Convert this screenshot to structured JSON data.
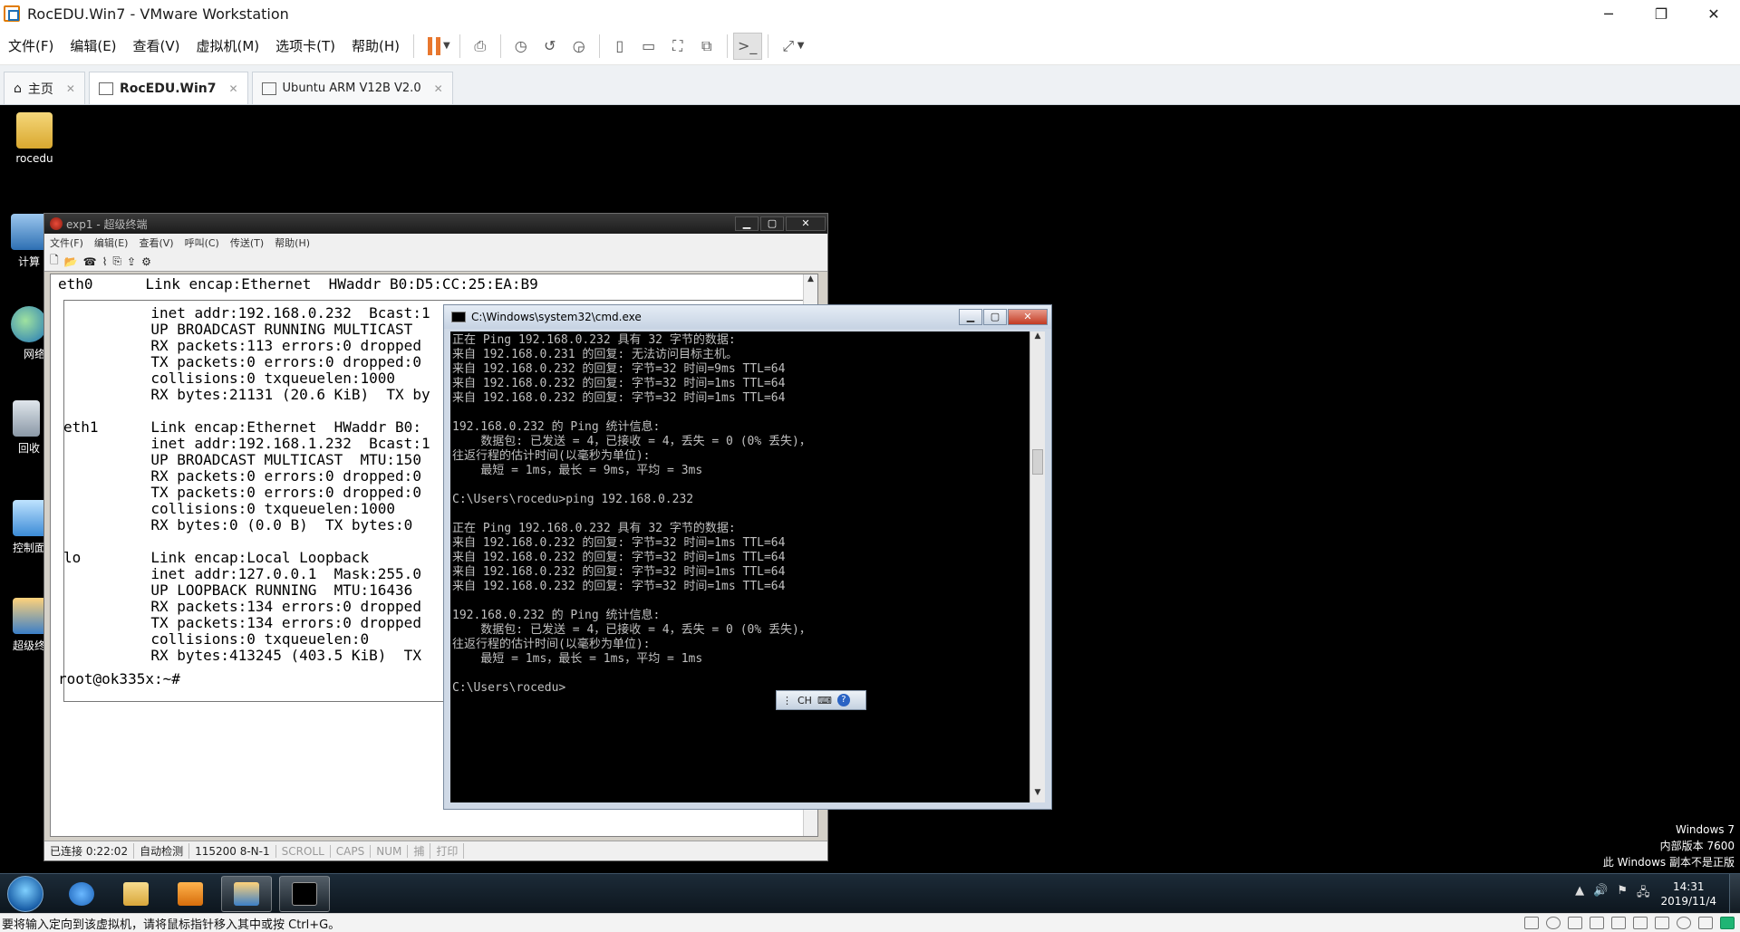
{
  "host": {
    "title": "RocEDU.Win7 - VMware Workstation",
    "window_controls": {
      "minimize": "─",
      "restore": "❐",
      "close": "✕"
    },
    "menu": [
      "文件(F)",
      "编辑(E)",
      "查看(V)",
      "虚拟机(M)",
      "选项卡(T)",
      "帮助(H)"
    ],
    "toolbar_icons": [
      "pause-icon",
      "send-ctrl-alt-del-icon",
      "snapshot-icon",
      "revert-snapshot-icon",
      "snapshot-manager-icon",
      "library-view-icon",
      "thumbnail-view-icon",
      "fullscreen-icon",
      "unity-icon",
      "console-view-icon",
      "stretch-guest-icon"
    ],
    "accent_color": "#e8772e",
    "tabs": [
      {
        "label": "主页",
        "icon": "home-icon",
        "active": false
      },
      {
        "label": "RocEDU.Win7",
        "icon": "vm-icon",
        "active": true
      },
      {
        "label": "Ubuntu ARM V12B V2.0",
        "icon": "vm-icon",
        "active": false
      }
    ],
    "status_message": "要将输入定向到该虚拟机，请将鼠标指针移入其中或按 Ctrl+G。"
  },
  "desktop": {
    "icons": [
      {
        "label": "rocedu",
        "icon": "user-folder-icon"
      },
      {
        "label": "计算",
        "icon": "computer-icon"
      },
      {
        "label": "网络",
        "icon": "network-icon"
      },
      {
        "label": "回收",
        "icon": "recycle-bin-icon"
      },
      {
        "label": "控制面",
        "icon": "control-panel-icon"
      },
      {
        "label": "超级终",
        "icon": "hyperterminal-icon"
      }
    ],
    "watermark": [
      "Windows 7",
      "内部版本 7600",
      "此 Windows 副本不是正版"
    ]
  },
  "hyperterminal": {
    "title": "exp1 - 超级终端",
    "menu": [
      "文件(F)",
      "编辑(E)",
      "查看(V)",
      "呼叫(C)",
      "传送(T)",
      "帮助(H)"
    ],
    "toolbar": [
      "🗋",
      "📂",
      "☎",
      "⌇",
      "⎘",
      "⇪",
      "⚙"
    ],
    "header_line": "eth0      Link encap:Ethernet  HWaddr B0:D5:CC:25:EA:B9",
    "lines": [
      "          inet addr:192.168.0.232  Bcast:1",
      "          UP BROADCAST RUNNING MULTICAST",
      "          RX packets:113 errors:0 dropped",
      "          TX packets:0 errors:0 dropped:0",
      "          collisions:0 txqueuelen:1000",
      "          RX bytes:21131 (20.6 KiB)  TX by",
      "",
      "eth1      Link encap:Ethernet  HWaddr B0:",
      "          inet addr:192.168.1.232  Bcast:1",
      "          UP BROADCAST MULTICAST  MTU:150",
      "          RX packets:0 errors:0 dropped:0",
      "          TX packets:0 errors:0 dropped:0",
      "          collisions:0 txqueuelen:1000",
      "          RX bytes:0 (0.0 B)  TX bytes:0",
      "",
      "lo        Link encap:Local Loopback",
      "          inet addr:127.0.0.1  Mask:255.0",
      "          UP LOOPBACK RUNNING  MTU:16436",
      "          RX packets:134 errors:0 dropped",
      "          TX packets:134 errors:0 dropped",
      "          collisions:0 txqueuelen:0",
      "          RX bytes:413245 (403.5 KiB)  TX"
    ],
    "prompt": "root@ok335x:~#",
    "status": [
      "已连接 0:22:02",
      "自动检测",
      "115200 8-N-1",
      "SCROLL",
      "CAPS",
      "NUM",
      "捕",
      "打印"
    ]
  },
  "cmd": {
    "title": "C:\\Windows\\system32\\cmd.exe",
    "lines": [
      "正在 Ping 192.168.0.232 具有 32 字节的数据:",
      "来自 192.168.0.231 的回复: 无法访问目标主机。",
      "来自 192.168.0.232 的回复: 字节=32 时间=9ms TTL=64",
      "来自 192.168.0.232 的回复: 字节=32 时间=1ms TTL=64",
      "来自 192.168.0.232 的回复: 字节=32 时间=1ms TTL=64",
      "",
      "192.168.0.232 的 Ping 统计信息:",
      "    数据包: 已发送 = 4，已接收 = 4，丢失 = 0 (0% 丢失)，",
      "往返行程的估计时间(以毫秒为单位):",
      "    最短 = 1ms，最长 = 9ms，平均 = 3ms",
      "",
      "C:\\Users\\rocedu>ping 192.168.0.232",
      "",
      "正在 Ping 192.168.0.232 具有 32 字节的数据:",
      "来自 192.168.0.232 的回复: 字节=32 时间=1ms TTL=64",
      "来自 192.168.0.232 的回复: 字节=32 时间=1ms TTL=64",
      "来自 192.168.0.232 的回复: 字节=32 时间=1ms TTL=64",
      "来自 192.168.0.232 的回复: 字节=32 时间=1ms TTL=64",
      "",
      "192.168.0.232 的 Ping 统计信息:",
      "    数据包: 已发送 = 4，已接收 = 4，丢失 = 0 (0% 丢失)，",
      "往返行程的估计时间(以毫秒为单位):",
      "    最短 = 1ms，最长 = 1ms，平均 = 1ms",
      "",
      "C:\\Users\\rocedu>"
    ]
  },
  "ime": {
    "label": "CH",
    "help": "?"
  },
  "taskbar": {
    "buttons": [
      {
        "name": "ie",
        "icon": "internet-explorer-icon"
      },
      {
        "name": "explorer",
        "icon": "file-explorer-icon"
      },
      {
        "name": "media",
        "icon": "media-player-icon"
      },
      {
        "name": "hyperterminal",
        "icon": "hyperterminal-icon"
      },
      {
        "name": "cmd",
        "icon": "command-prompt-icon"
      }
    ],
    "tray_icons": [
      "▲",
      "🔊",
      "⚑",
      "🖧"
    ],
    "time": "14:31",
    "date": "2019/11/4"
  }
}
